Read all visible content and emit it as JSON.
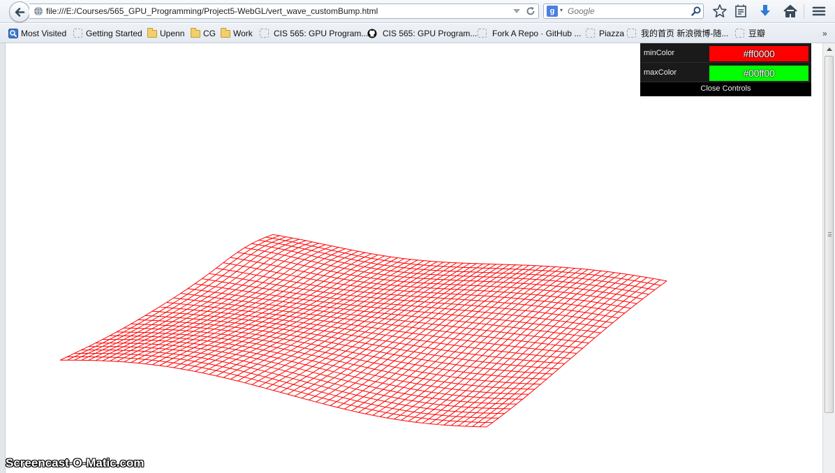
{
  "browser": {
    "url": "file:///E:/Courses/565_GPU_Programming/Project5-WebGL/vert_wave_customBump.html",
    "search_placeholder": "Google",
    "search_engine_icon": "google-icon"
  },
  "bookmarks": [
    {
      "label": "Most Visited",
      "icon": "most-visited-icon"
    },
    {
      "label": "Getting Started",
      "icon": "page-icon"
    },
    {
      "label": "Upenn",
      "icon": "folder-icon"
    },
    {
      "label": "CG",
      "icon": "folder-icon"
    },
    {
      "label": "Work",
      "icon": "folder-icon"
    },
    {
      "label": "CIS 565: GPU Program...",
      "icon": "page-icon"
    },
    {
      "label": "CIS 565: GPU Program...",
      "icon": "github-icon"
    },
    {
      "label": "Fork A Repo · GitHub ...",
      "icon": "page-icon"
    },
    {
      "label": "Piazza",
      "icon": "page-icon"
    },
    {
      "label": "我的首页 新浪微博-随...",
      "icon": "page-icon"
    },
    {
      "label": "豆瓣",
      "icon": "page-icon"
    }
  ],
  "bookmarks_overflow": "»",
  "gui": {
    "controls": [
      {
        "name": "minColor",
        "value": "#ff0000",
        "color": "#ff0000"
      },
      {
        "name": "maxColor",
        "value": "#00ff00",
        "color": "#00ff00"
      }
    ],
    "close_label": "Close Controls"
  },
  "mesh": {
    "color": "#ff0000",
    "rows": 30,
    "cols": 60
  },
  "watermark": "Screencast-O-Matic.com"
}
